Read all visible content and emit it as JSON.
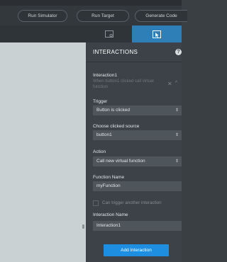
{
  "toolbar": {
    "run_simulator": "Run Simulator",
    "run_target": "Run Target",
    "generate_code": "Generate Code"
  },
  "panel": {
    "title": "INTERACTIONS",
    "help": "?"
  },
  "interaction": {
    "title": "Interaction1",
    "description": "When button1 clicked call virtual function",
    "close": "✕",
    "collapse": "^"
  },
  "form": {
    "trigger_label": "Trigger",
    "trigger_value": "Button is clicked",
    "source_label": "Choose clicked source",
    "source_value": "button1",
    "action_label": "Action",
    "action_value": "Call new virtual function",
    "function_name_label": "Function Name",
    "function_name_value": "myFunction",
    "can_trigger_label": "Can trigger another interaction",
    "interaction_name_label": "Interaction Name",
    "interaction_name_value": "Interaction1",
    "add_button": "Add Interaction",
    "updown": "⇕"
  },
  "colors": {
    "accent": "#1e8fe0",
    "active_tab": "#2e7fb8",
    "panel_bg": "#3c4247",
    "canvas_bg": "#c9d1d3"
  },
  "icons": {
    "design_tab": "screen-icon",
    "interactions_tab": "interaction-icon"
  }
}
